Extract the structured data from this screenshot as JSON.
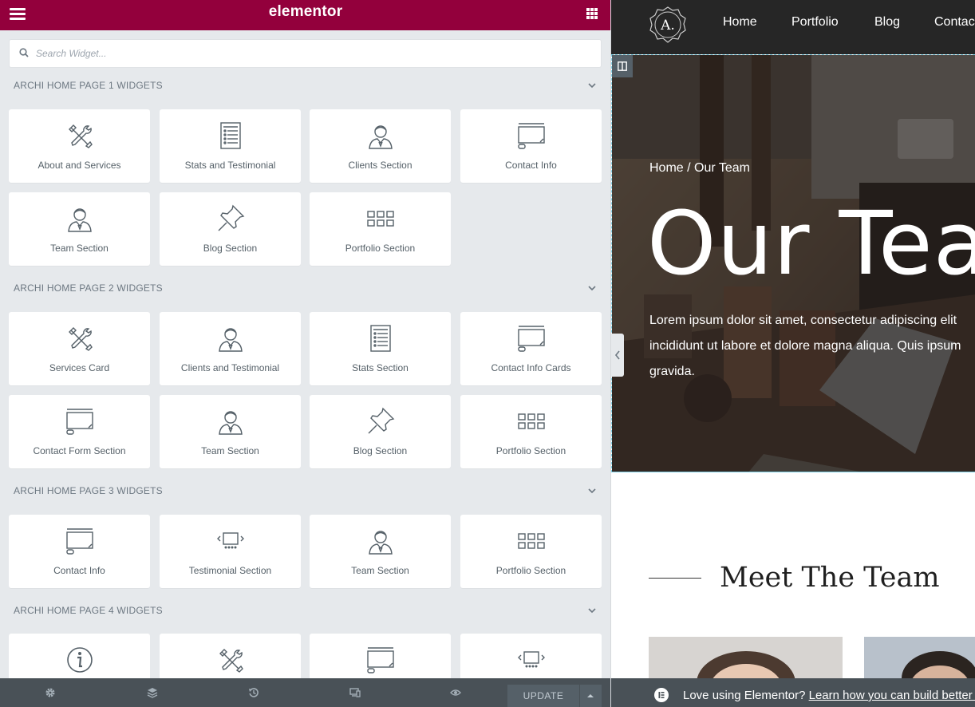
{
  "panel": {
    "logo": "elementor",
    "search_placeholder": "Search Widget...",
    "categories": [
      {
        "title": "ARCHI HOME PAGE 1 WIDGETS",
        "widgets": [
          {
            "label": "About and Services",
            "icon": "tools-icon"
          },
          {
            "label": "Stats and Testimonial",
            "icon": "list-icon"
          },
          {
            "label": "Clients Section",
            "icon": "person-icon"
          },
          {
            "label": "Contact Info",
            "icon": "form-icon"
          },
          {
            "label": "Team Section",
            "icon": "person-icon"
          },
          {
            "label": "Blog Section",
            "icon": "pin-icon"
          },
          {
            "label": "Portfolio Section",
            "icon": "gallery-icon"
          }
        ]
      },
      {
        "title": "ARCHI HOME PAGE 2 WIDGETS",
        "widgets": [
          {
            "label": "Services Card",
            "icon": "tools-icon"
          },
          {
            "label": "Clients and Testimonial",
            "icon": "person-icon"
          },
          {
            "label": "Stats Section",
            "icon": "list-icon"
          },
          {
            "label": "Contact Info Cards",
            "icon": "form-icon"
          },
          {
            "label": "Contact Form Section",
            "icon": "form-icon"
          },
          {
            "label": "Team Section",
            "icon": "person-icon"
          },
          {
            "label": "Blog Section",
            "icon": "pin-icon"
          },
          {
            "label": "Portfolio Section",
            "icon": "gallery-icon"
          }
        ]
      },
      {
        "title": "ARCHI HOME PAGE 3 WIDGETS",
        "widgets": [
          {
            "label": "Contact Info",
            "icon": "form-icon"
          },
          {
            "label": "Testimonial Section",
            "icon": "slider-icon"
          },
          {
            "label": "Team Section",
            "icon": "person-icon"
          },
          {
            "label": "Portfolio Section",
            "icon": "gallery-icon"
          }
        ]
      },
      {
        "title": "ARCHI HOME PAGE 4 WIDGETS",
        "widgets": [
          {
            "label": "",
            "icon": "info-icon"
          },
          {
            "label": "",
            "icon": "tools-icon"
          },
          {
            "label": "",
            "icon": "form-icon"
          },
          {
            "label": "",
            "icon": "slider-icon"
          }
        ]
      }
    ],
    "footer": {
      "update_label": "UPDATE"
    }
  },
  "preview": {
    "site_logo": "A.",
    "nav": [
      "Home",
      "Portfolio",
      "Blog",
      "Contact"
    ],
    "breadcrumb": "Home / Our Team",
    "hero_title": "Our Team",
    "hero_text": [
      "Lorem ipsum dolor sit amet, consectetur adipiscing elit",
      "incididunt ut labore et dolore magna aliqua. Quis ipsum",
      "gravida."
    ],
    "meet_title": "Meet The Team",
    "notice_text": "Love using Elementor?",
    "notice_link": "Learn how you can build better s"
  },
  "colors": {
    "brand": "#93003c",
    "panel_bg": "#e6e9ec",
    "footer_bg": "#495157",
    "nav_bg": "#262626",
    "accent_outline": "#7ed0e6"
  }
}
